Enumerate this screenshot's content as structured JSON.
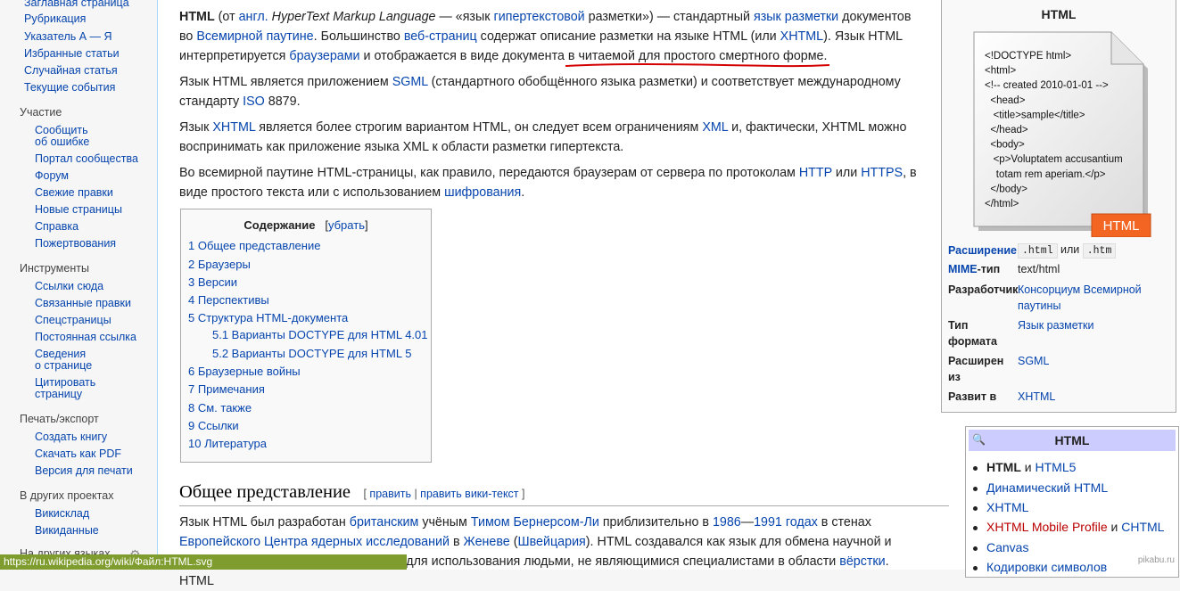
{
  "sidebar": {
    "nav": [
      "Заглавная страница",
      "Рубрикация",
      "Указатель А — Я",
      "Избранные статьи",
      "Случайная статья",
      "Текущие события"
    ],
    "participation_head": "Участие",
    "participation": [
      "Сообщить",
      "об ошибке",
      "Портал сообщества",
      "Форум",
      "Свежие правки",
      "Новые страницы",
      "Справка",
      "Пожертвования"
    ],
    "tools_head": "Инструменты",
    "tools": [
      "Ссылки сюда",
      "Связанные правки",
      "Спецстраницы",
      "Постоянная ссылка",
      "Сведения",
      "о странице",
      "Цитировать",
      "страницу"
    ],
    "print_head": "Печать/экспорт",
    "print": [
      "Создать книгу",
      "Скачать как PDF",
      "Версия для печати"
    ],
    "projects_head": "В других проектах",
    "projects": [
      "Викисклад",
      "Викиданные"
    ],
    "languages_head": "На других языках"
  },
  "article": {
    "p1": {
      "t1": "HTML",
      "t2": " (от ",
      "l1": "англ.",
      "t3": " ",
      "t4": "HyperText Markup Language",
      "t5": " — «язык ",
      "l2": "гипертекстовой",
      "t6": " разметки») — стандартный ",
      "l3": "язык разметки",
      "t7": " документов во ",
      "l4": "Всемирной паутине",
      "t8": ". Большинство ",
      "l5": "веб-страниц",
      "t9": " содержат описание разметки на языке HTML (или ",
      "l6": "XHTML",
      "t10": "). Язык HTML интерпретируется ",
      "l7": "браузерами",
      "t11": " и отображается в виде документа в читаемой для простого смертного форме."
    },
    "p2": {
      "t1": "Язык HTML является приложением ",
      "l1": "SGML",
      "t2": " (стандартного обобщённого языка разметки) и соответствует международному стандарту ",
      "l2": "ISO",
      "t3": " 8879."
    },
    "p3": {
      "t1": "Язык ",
      "l1": "XHTML",
      "t2": " является более строгим вариантом HTML, он следует всем ограничениям ",
      "l2": "XML",
      "t3": " и, фактически, XHTML можно воспринимать как приложение языка XML к области разметки гипертекста."
    },
    "p4": {
      "t1": "Во всемирной паутине HTML-страницы, как правило, передаются браузерам от сервера по протоколам ",
      "l1": "HTTP",
      "t2": " или ",
      "l2": "HTTPS",
      "t3": ", в виде простого текста или с использованием ",
      "l3": "шифрования",
      "t4": "."
    },
    "toc": {
      "title": "Содержание",
      "toggle": "убрать",
      "items": [
        "1 Общее представление",
        "2 Браузеры",
        "3 Версии",
        "4 Перспективы",
        "5 Структура HTML-документа",
        "5.1 Варианты DOCTYPE для HTML 4.01",
        "5.2 Варианты DOCTYPE для HTML 5",
        "6 Браузерные войны",
        "7 Примечания",
        "8 См. также",
        "9 Ссылки",
        "10 Литература"
      ]
    },
    "section": {
      "heading": "Общее представление",
      "edit": "править",
      "edit_wiki": "править вики-текст"
    },
    "p5": {
      "t1": "Язык HTML был разработан ",
      "l1": "британским",
      "t2": " учёным ",
      "l2": "Тимом Бернерсом-Ли",
      "t3": " приблизительно в ",
      "l3": "1986",
      "t4": "—",
      "l4": "1991 годах",
      "t5": " в стенах ",
      "l5": "Европейского Центра ядерных исследований",
      "t6": " в ",
      "l6": "Женеве",
      "t7": " (",
      "l7": "Швейцария",
      "t8": "). HTML создавался как язык для обмена научной и",
      "t9": "ый для использования людьми, не являющимися специалистами в области ",
      "l8": "вёрстки",
      "t10": ". HTML"
    }
  },
  "infobox": {
    "title": "HTML",
    "code_lines": [
      "<!DOCTYPE html>",
      "<html>",
      "<!-- created 2010-01-01 -->",
      "  <head>",
      "   <title>sample</title>",
      "  </head>",
      "  <body>",
      "   <p>Voluptatem accusantium",
      "    totam rem aperiam.</p>",
      "  </body>",
      "</html>"
    ],
    "badge": "HTML",
    "rows": {
      "ext_label": "Расширение",
      "ext_val1": ".html",
      "ext_or": "или",
      "ext_val2": ".htm",
      "mime_label_a": "MIME",
      "mime_label_b": "-тип",
      "mime_val": "text/html",
      "dev_label": "Разработчик",
      "dev_val1": "Консорциум Всемирной",
      "dev_val2": "паутины",
      "type_label1": "Тип",
      "type_label2": "формата",
      "type_val": "Язык разметки",
      "ext_from_label1": "Расширен",
      "ext_from_label2": "из",
      "ext_from_val": "SGML",
      "evolved_label": "Развит в",
      "evolved_val": "XHTML"
    }
  },
  "navbox": {
    "title": "HTML",
    "i1a": "HTML",
    "i1b": " и ",
    "i1c": "HTML5",
    "i2": "Динамический HTML",
    "i3": "XHTML",
    "i4a": "XHTML Mobile Profile",
    "i4b": " и ",
    "i4c": "CHTML",
    "i5": "Canvas",
    "i6": "Кодировки символов"
  },
  "status": {
    "url": "https://ru.wikipedia.org/wiki/Файл:HTML.svg"
  },
  "watermark": "pikabu.ru",
  "colors": {
    "link": "#0645ad",
    "redlink": "#ba0000",
    "status_bar": "#7f9c2e",
    "badge": "#f26522",
    "navbox_title": "#ccccff"
  }
}
